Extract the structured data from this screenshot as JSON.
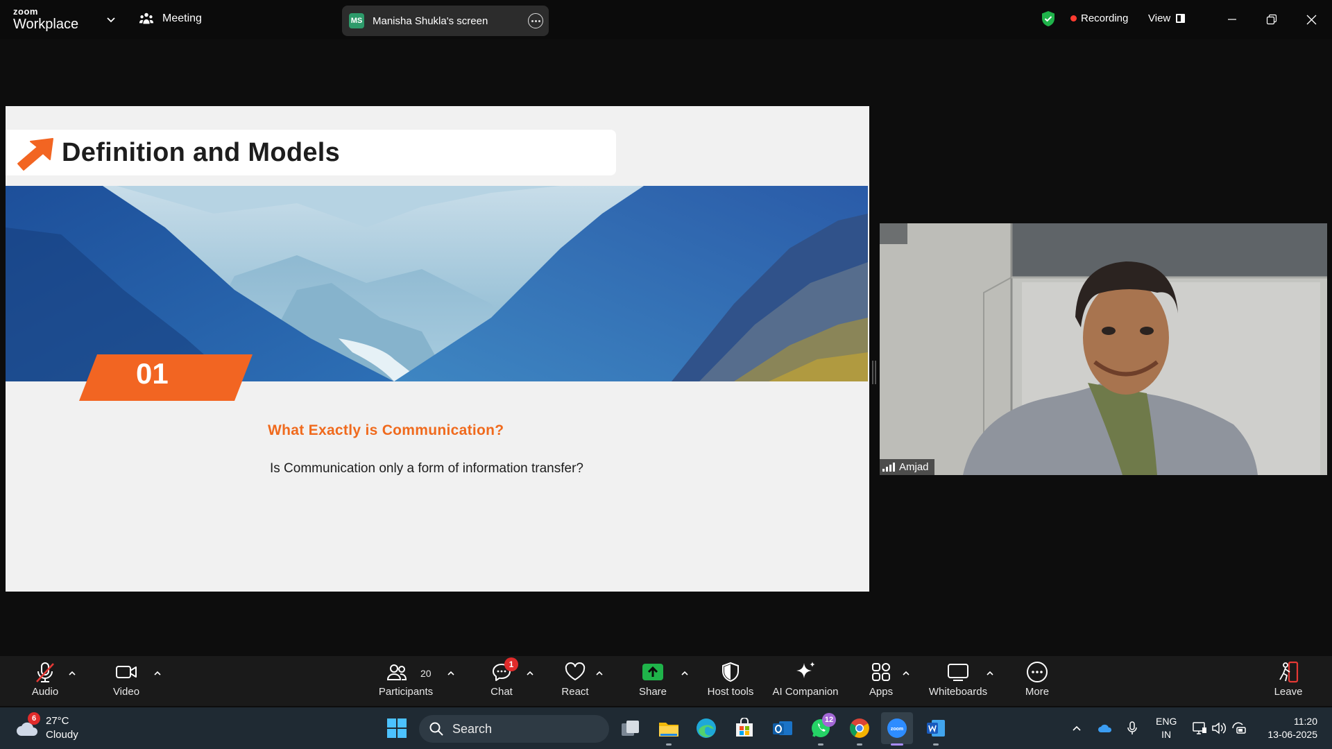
{
  "app": {
    "brand_top": "zoom",
    "brand_main": "Workplace",
    "meeting_label": "Meeting",
    "screen_share": {
      "initials": "MS",
      "label": "Manisha Shukla's screen"
    },
    "recording_label": "Recording",
    "view_label": "View"
  },
  "slide": {
    "title": "Definition and Models",
    "number": "01",
    "question_title": "What Exactly is Communication?",
    "question_body": "Is Communication only a form of information transfer?",
    "accent_color": "#f26522"
  },
  "video": {
    "participant_name": "Amjad"
  },
  "toolbar": {
    "audio": "Audio",
    "video": "Video",
    "participants": "Participants",
    "participants_count": "20",
    "chat": "Chat",
    "chat_badge": "1",
    "react": "React",
    "share": "Share",
    "host_tools": "Host tools",
    "ai_companion": "AI Companion",
    "apps": "Apps",
    "whiteboards": "Whiteboards",
    "more": "More",
    "leave": "Leave"
  },
  "taskbar": {
    "weather_badge": "6",
    "temperature": "27°C",
    "condition": "Cloudy",
    "search_label": "Search",
    "whatsapp_badge": "12",
    "lang_top": "ENG",
    "lang_bottom": "IN",
    "time": "11:20",
    "date": "13-06-2025"
  }
}
